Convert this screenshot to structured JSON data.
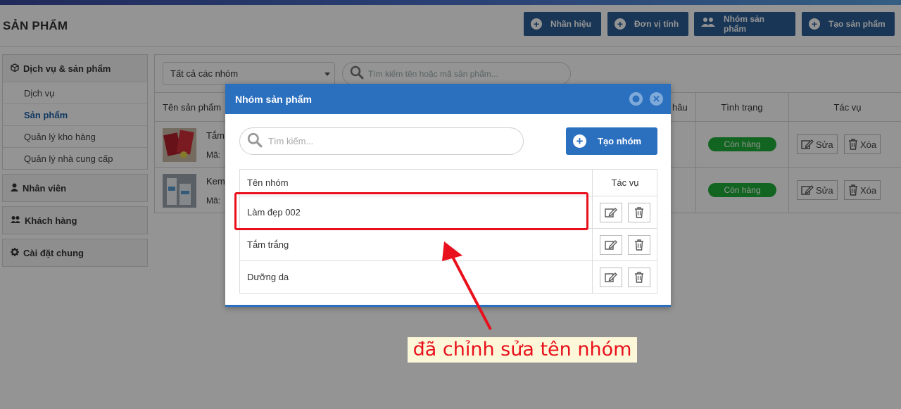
{
  "header": {
    "title": "SẢN PHẨM",
    "buttons": [
      {
        "label": "Nhãn hiệu"
      },
      {
        "label": "Đơn vị tính"
      },
      {
        "label": "Nhóm sản phẩm"
      },
      {
        "label": "Tạo sản phẩm"
      }
    ]
  },
  "sidebar": {
    "groups": [
      {
        "label": "Dịch vụ & sản phẩm",
        "items": [
          {
            "label": "Dịch vụ"
          },
          {
            "label": "Sản phẩm"
          },
          {
            "label": "Quản lý kho hàng"
          },
          {
            "label": "Quản lý nhà cung cấp"
          }
        ]
      },
      {
        "label": "Nhân viên"
      },
      {
        "label": "Khách hàng"
      },
      {
        "label": "Cài đặt chung"
      }
    ]
  },
  "filter": {
    "group_select": "Tất cả các nhóm",
    "search_placeholder": "Tìm kiếm tên hoặc mã sản phẩm..."
  },
  "products_table": {
    "col_name": "Tên sản phẩm",
    "col_partial": "hâu",
    "col_status": "Tình trạng",
    "col_actions": "Tác vụ",
    "rows": [
      {
        "name": "Tắm",
        "code": "Mã:",
        "status": "Còn hàng",
        "edit": "Sửa",
        "delete": "Xóa"
      },
      {
        "name": "Kem",
        "code": "Mã:",
        "status": "Còn hàng",
        "edit": "Sửa",
        "delete": "Xóa"
      }
    ]
  },
  "modal": {
    "title": "Nhóm sản phẩm",
    "search_placeholder": "Tìm kiếm...",
    "create_label": "Tạo nhóm",
    "col_name": "Tên nhóm",
    "col_actions": "Tác vụ",
    "groups": [
      {
        "name": "Làm đẹp 002"
      },
      {
        "name": "Tắm trắng"
      },
      {
        "name": "Dưỡng da"
      }
    ]
  },
  "annotation": {
    "text": "đã chỉnh sửa tên nhóm"
  },
  "colors": {
    "primary": "#2b6fbf",
    "header_button": "#2b5e94",
    "status_green": "#1fae38",
    "highlight_red": "#e8101c"
  }
}
